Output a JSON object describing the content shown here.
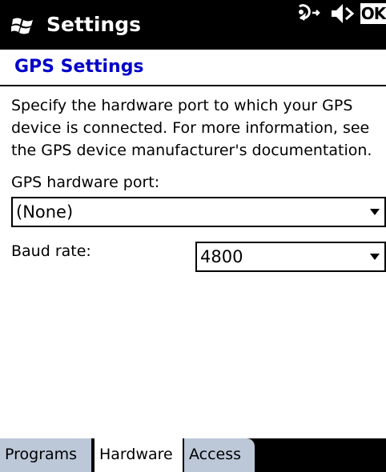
{
  "titlebar": {
    "title": "Settings",
    "icons": [
      "windows-start-icon",
      "connectivity-icon",
      "volume-icon"
    ],
    "ok_label": "OK"
  },
  "page": {
    "title": "GPS Settings",
    "title_color": "#0000c8"
  },
  "content": {
    "description": "Specify the hardware port to which your GPS device is connected. For more information, see the GPS device manufacturer's documentation.",
    "port_label": "GPS hardware port:",
    "port_value": "(None)",
    "baud_label": "Baud rate:",
    "baud_value": "4800"
  },
  "tabs": [
    {
      "label": "Programs",
      "active": false
    },
    {
      "label": "Hardware",
      "active": true
    },
    {
      "label": "Access",
      "active": false
    }
  ]
}
